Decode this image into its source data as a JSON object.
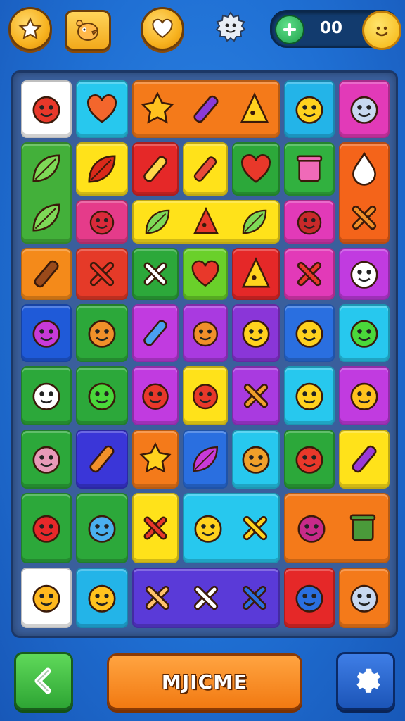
{
  "top_bar": {
    "counter_value": "00",
    "icons": [
      "star-icon",
      "chick-icon",
      "heart-icon",
      "gear-face-icon",
      "plus-icon",
      "smiley-coin-icon"
    ]
  },
  "board": {
    "tiles": [
      {
        "name": "tile-red-bird",
        "color": "#ffffff",
        "icons": [
          "red-bird"
        ]
      },
      {
        "name": "tile-heart",
        "color": "#27c8ee",
        "icons": [
          "heart"
        ]
      },
      {
        "name": "tile-sun-carrot-cheese",
        "color": "#f47a1a",
        "icons": [
          "sun",
          "carrot",
          "cheese"
        ]
      },
      {
        "name": "tile-yellow-smiley",
        "color": "#23b4e8",
        "icons": [
          "yellow-smiley"
        ]
      },
      {
        "name": "tile-koala",
        "color": "#e23ab8",
        "icons": [
          "koala"
        ]
      },
      {
        "name": "tile-leaves",
        "color": "#43b03a",
        "icons": [
          "leaf",
          "leaf"
        ]
      },
      {
        "name": "tile-red-leaf",
        "color": "#ffe21a",
        "icons": [
          "red-leaf"
        ]
      },
      {
        "name": "tile-pencil",
        "color": "#e52828",
        "icons": [
          "pencil"
        ]
      },
      {
        "name": "tile-rocket",
        "color": "#ffe21a",
        "icons": [
          "rocket"
        ]
      },
      {
        "name": "tile-red-heart",
        "color": "#2ca83a",
        "icons": [
          "red-heart"
        ]
      },
      {
        "name": "tile-robot",
        "color": "#31b13f",
        "icons": [
          "robot"
        ]
      },
      {
        "name": "tile-drop-fox",
        "color": "#f4641a",
        "icons": [
          "drop",
          "fox"
        ]
      },
      {
        "name": "tile-red-fish",
        "color": "#e53b8a",
        "icons": [
          "red-fish"
        ]
      },
      {
        "name": "tile-leaves-yellow",
        "color": "#ffe21a",
        "icons": [
          "leaf",
          "red-cone",
          "leaf"
        ]
      },
      {
        "name": "tile-red-lizard",
        "color": "#e23ab8",
        "icons": [
          "red-lizard"
        ]
      },
      {
        "name": "tile-log",
        "color": "#f48a1a",
        "icons": [
          "log"
        ]
      },
      {
        "name": "tile-red-cross",
        "color": "#e53a28",
        "icons": [
          "red-cross"
        ]
      },
      {
        "name": "tile-sticks",
        "color": "#2ca83a",
        "icons": [
          "sticks"
        ]
      },
      {
        "name": "tile-heart-2",
        "color": "#6ad02a",
        "icons": [
          "red-heart"
        ]
      },
      {
        "name": "tile-cheese",
        "color": "#e52828",
        "icons": [
          "cheese"
        ]
      },
      {
        "name": "tile-red-cross-2",
        "color": "#e23ab8",
        "icons": [
          "red-cross"
        ]
      },
      {
        "name": "tile-monster",
        "color": "#c13be0",
        "icons": [
          "monster"
        ]
      },
      {
        "name": "tile-purple-blob",
        "color": "#1f5ad8",
        "icons": [
          "purple-blob"
        ]
      },
      {
        "name": "tile-acorn",
        "color": "#2ca83a",
        "icons": [
          "acorn"
        ]
      },
      {
        "name": "tile-hammer",
        "color": "#c13be0",
        "icons": [
          "hammer"
        ]
      },
      {
        "name": "tile-orange-bird",
        "color": "#a93ae0",
        "icons": [
          "orange-bird"
        ]
      },
      {
        "name": "tile-bee",
        "color": "#8a36d8",
        "icons": [
          "bee"
        ]
      },
      {
        "name": "tile-yellow-fish",
        "color": "#2a6fe0",
        "icons": [
          "yellow-fish"
        ]
      },
      {
        "name": "tile-green-fish",
        "color": "#27c8ee",
        "icons": [
          "green-fish"
        ]
      },
      {
        "name": "tile-chicken",
        "color": "#2ca83a",
        "icons": [
          "chicken"
        ]
      },
      {
        "name": "tile-green-blob",
        "color": "#2ca83a",
        "icons": [
          "green-blob"
        ]
      },
      {
        "name": "tile-red-ball",
        "color": "#c13be0",
        "icons": [
          "red-ball"
        ]
      },
      {
        "name": "tile-bomb",
        "color": "#ffe21a",
        "icons": [
          "bomb"
        ]
      },
      {
        "name": "tile-orange-x",
        "color": "#a93ae0",
        "icons": [
          "orange-x"
        ]
      },
      {
        "name": "tile-ring",
        "color": "#27c8ee",
        "icons": [
          "ring"
        ]
      },
      {
        "name": "tile-duck",
        "color": "#c13be0",
        "icons": [
          "duck"
        ]
      },
      {
        "name": "tile-turnip",
        "color": "#2ca83a",
        "icons": [
          "turnip"
        ]
      },
      {
        "name": "tile-torch",
        "color": "#3a36d8",
        "icons": [
          "torch"
        ]
      },
      {
        "name": "tile-star",
        "color": "#f47a1a",
        "icons": [
          "star"
        ]
      },
      {
        "name": "tile-feather",
        "color": "#2a6fe0",
        "icons": [
          "feather"
        ]
      },
      {
        "name": "tile-pineapple",
        "color": "#27c8ee",
        "icons": [
          "pineapple"
        ]
      },
      {
        "name": "tile-green-ball",
        "color": "#2ca83a",
        "icons": [
          "green-ball"
        ]
      },
      {
        "name": "tile-crayon",
        "color": "#ffe21a",
        "icons": [
          "crayon"
        ]
      },
      {
        "name": "tile-strawberry",
        "color": "#2ca83a",
        "icons": [
          "strawberry"
        ]
      },
      {
        "name": "tile-balloon",
        "color": "#2ca83a",
        "icons": [
          "balloon"
        ]
      },
      {
        "name": "tile-red-x",
        "color": "#ffe21a",
        "icons": [
          "red-x"
        ]
      },
      {
        "name": "tile-bird-x",
        "color": "#27c8ee",
        "icons": [
          "yellow-bird",
          "yellow-x"
        ]
      },
      {
        "name": "tile-beet-trash",
        "color": "#f47a1a",
        "icons": [
          "beet",
          "trash-can"
        ]
      },
      {
        "name": "tile-orange",
        "color": "#ffffff",
        "icons": [
          "orange-fruit"
        ]
      },
      {
        "name": "tile-sun-face",
        "color": "#23b4e8",
        "icons": [
          "sun-face"
        ]
      },
      {
        "name": "tile-sword-box",
        "color": "#5a3ad8",
        "icons": [
          "crossed-sticks",
          "sword",
          "box"
        ]
      },
      {
        "name": "tile-earth",
        "color": "#e52828",
        "icons": [
          "earth"
        ]
      },
      {
        "name": "tile-bear",
        "color": "#f47a1a",
        "icons": [
          "bear"
        ]
      }
    ]
  },
  "bottom_bar": {
    "main_button_label": "MJICME",
    "back_icon": "chevron-left-icon",
    "settings_icon": "gear-icon"
  }
}
